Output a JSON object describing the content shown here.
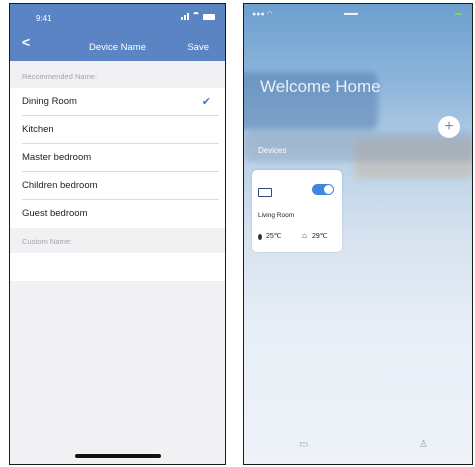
{
  "left": {
    "status_time": "9:41",
    "nav": {
      "back": "<",
      "title": "Device Name",
      "save": "Save"
    },
    "recommended_header": "Recommended Name:",
    "items": [
      {
        "label": "Dining Room",
        "selected": true
      },
      {
        "label": "Kitchen",
        "selected": false
      },
      {
        "label": "Master bedroom",
        "selected": false
      },
      {
        "label": "Children bedroom",
        "selected": false
      },
      {
        "label": "Guest bedroom",
        "selected": false
      }
    ],
    "check": "✔",
    "custom_header": "Custom Name:",
    "custom_value": ""
  },
  "right": {
    "welcome": "Welcome Home",
    "add": "+",
    "devices_label": "Devices",
    "card": {
      "name": "Living Room",
      "temp_set": "25℃",
      "temp_indoor": "29℃",
      "power_on": true
    }
  },
  "icons": {
    "back": "chevron-left-icon",
    "check": "check-icon",
    "add": "plus-icon",
    "ac": "air-conditioner-icon",
    "home_indicator": "home-indicator"
  },
  "colors": {
    "nav_blue": "#5b84c4",
    "check_blue": "#3c7bd6",
    "toggle_blue": "#3d87e0"
  }
}
